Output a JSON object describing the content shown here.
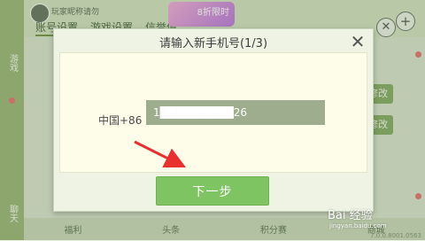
{
  "background": {
    "sidebar": {
      "games_label": "游戏",
      "chat_label": "聊天"
    },
    "username": "玩家昵称请勿",
    "tabs": [
      "账号设置",
      "游戏设置",
      "信誉值"
    ],
    "banner_text": "8折限时",
    "edit_label": "修改",
    "bottom_nav": [
      "福利",
      "头条",
      "积分赛",
      "商城"
    ],
    "version": "7.0.0.8001.0563"
  },
  "dialog": {
    "title": "请输入新手机号(1/3)",
    "close_symbol": "✕",
    "country_code": "中国+86",
    "phone_value": "1█████████26",
    "next_button": "下一步"
  },
  "watermark": {
    "text": "Bai 经验",
    "sub": "jingyan.baidu.com"
  },
  "colors": {
    "accent_green": "#7fc462",
    "input_bg": "#9ead8d",
    "arrow_red": "#e8312f"
  }
}
